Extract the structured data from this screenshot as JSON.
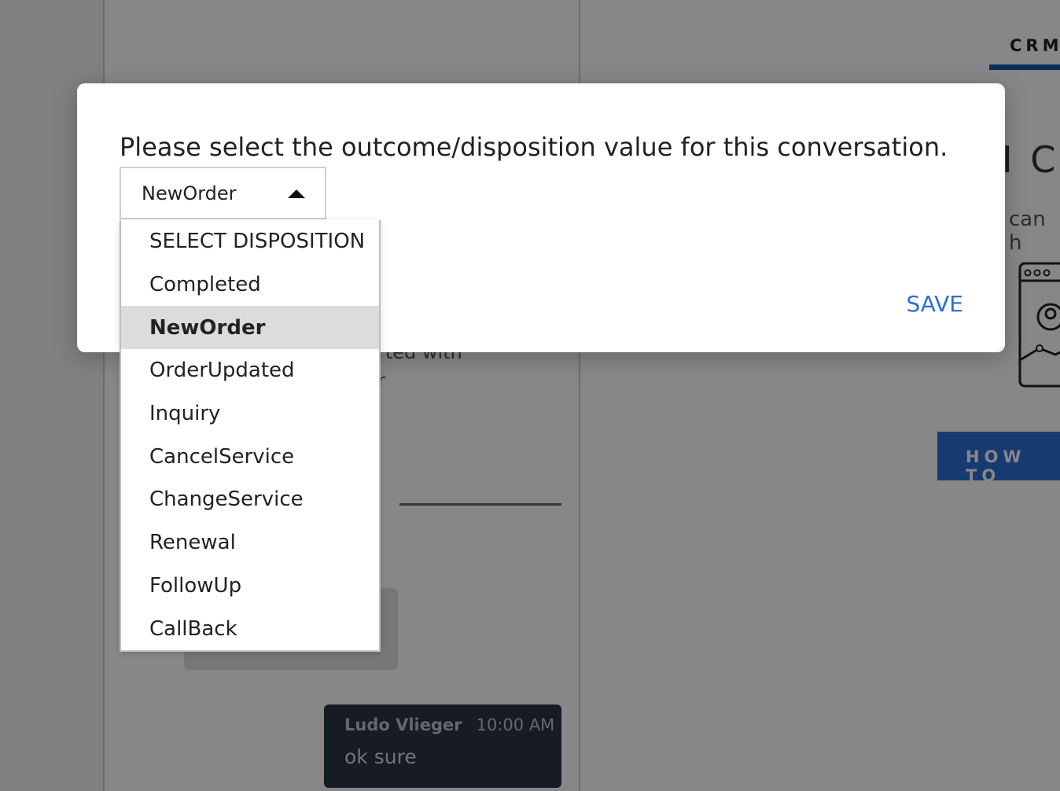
{
  "background": {
    "crm_tab_label": "CRM",
    "crm_heading_fragment": "I C",
    "crm_text_fragment": "can h",
    "howto_button_label": "HOW TO",
    "chat_text_fragment_1": "rted with",
    "chat_text_fragment_2": "r",
    "message": {
      "sender": "Ludo Vlieger",
      "time": "10:00 AM",
      "text": "ok sure"
    }
  },
  "modal": {
    "prompt": "Please select the outcome/disposition value for this conversation.",
    "select_value": "NewOrder",
    "save_label": "SAVE"
  },
  "dropdown": {
    "selected_index": 2,
    "options": [
      "SELECT DISPOSITION",
      "Completed",
      "NewOrder",
      "OrderUpdated",
      "Inquiry",
      "CancelService",
      "ChangeService",
      "Renewal",
      "FollowUp",
      "CallBack"
    ]
  },
  "colors": {
    "accent": "#2c6fd6",
    "overlay": "#000000",
    "selected_option_bg": "#dcdcdc"
  }
}
